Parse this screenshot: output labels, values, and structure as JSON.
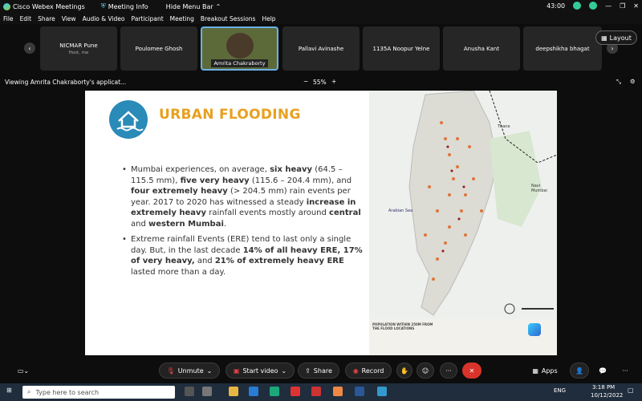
{
  "titlebar": {
    "app": "Cisco Webex Meetings",
    "meeting_info": "Meeting Info",
    "hide_menu": "Hide Menu Bar",
    "timer": "43:00"
  },
  "menu": [
    "File",
    "Edit",
    "Share",
    "View",
    "Audio & Video",
    "Participant",
    "Meeting",
    "Breakout Sessions",
    "Help"
  ],
  "participants": [
    {
      "name": "NICMAR Pune",
      "sub": "Host, me"
    },
    {
      "name": "Poulomee Ghosh",
      "sub": ""
    },
    {
      "name": "Amrita Chakraborty",
      "sub": ""
    },
    {
      "name": "Pallavi Avinashe",
      "sub": ""
    },
    {
      "name": "1135A Noopur Yelne",
      "sub": ""
    },
    {
      "name": "Anusha Kant",
      "sub": ""
    },
    {
      "name": "deepshikha bhagat",
      "sub": ""
    }
  ],
  "layout_label": "Layout",
  "viewing": "Viewing Amrita Chakraborty's applicat...",
  "zoom": "55%",
  "slide": {
    "title": "URBAN FLOODING",
    "b1_parts": [
      "Mumbai experiences, on average, ",
      "six heavy",
      " (64.5 – 115.5 mm), ",
      "five very heavy",
      " (115.6 – 204.4 mm), and ",
      "four extremely heavy",
      " (> 204.5 mm) rain events per year. 2017 to 2020 has witnessed a steady ",
      "increase in extremely heavy",
      " rainfall events mostly around ",
      "central",
      " and ",
      "western Mumbai",
      "."
    ],
    "b2_parts": [
      "Extreme rainfall Events (ERE) tend to last only a single day. But, in the last decade ",
      "14% of all heavy ERE, 17% of very heavy,",
      " and ",
      "21% of extremely heavy ERE",
      " lasted more than a day."
    ],
    "map_labels": {
      "thane": "Thane",
      "navi": "Navi Mumbai",
      "sea": "Arabian Sea",
      "legend": "POPULATION WITHIN 250M FROM THE FLOOD LOCATIONS"
    }
  },
  "controls": {
    "unmute": "Unmute",
    "start_video": "Start video",
    "share": "Share",
    "record": "Record",
    "apps": "Apps"
  },
  "taskbar": {
    "search": "Type here to search",
    "time": "3:18 PM",
    "date": "10/12/2022",
    "lang": "ENG"
  },
  "colors": {
    "accent_orange": "#e8a020",
    "logo_blue": "#2a8ab8",
    "end_red": "#d9342b"
  }
}
